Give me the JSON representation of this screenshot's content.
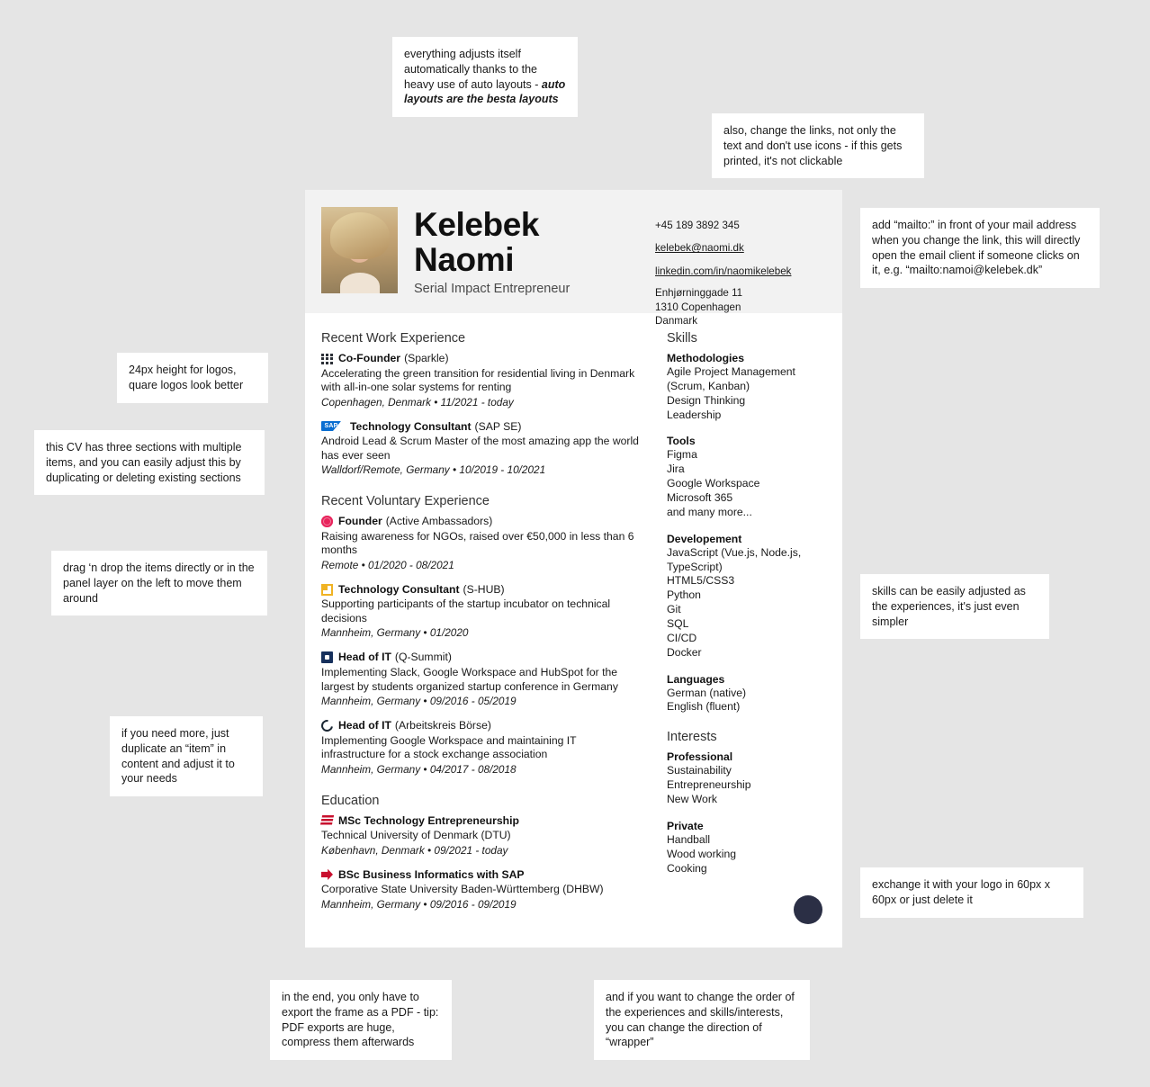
{
  "cv": {
    "header": {
      "photo_alt": "portrait-photo",
      "name": "Kelebek\nNaomi",
      "name_line1": "Kelebek",
      "name_line2": "Naomi",
      "subtitle": "Serial Impact Entrepreneur",
      "phone": "+45 189 3892 345",
      "email": "kelebek@naomi.dk",
      "linkedin": "linkedin.com/in/naomikelebek",
      "address_line1": "Enhjørninggade 11",
      "address_line2": "1310 Copenhagen",
      "address_line3": "Danmark"
    },
    "sections": [
      {
        "title": "Recent Work Experience",
        "items": [
          {
            "icon": "sparkle-logo-icon",
            "role": "Co-Founder",
            "org": "(Sparkle)",
            "desc": "Accelerating the green transition for residential living in Denmark with all-in-one solar systems for renting",
            "meta": "Copenhagen, Denmark • 11/2021 - today"
          },
          {
            "icon": "sap-logo-icon",
            "role": "Technology Consultant",
            "org": "(SAP SE)",
            "desc": "Android Lead & Scrum Master of the most amazing app the world has ever seen",
            "meta": "Walldorf/Remote, Germany • 10/2019 - 10/2021"
          }
        ]
      },
      {
        "title": "Recent Voluntary Experience",
        "items": [
          {
            "icon": "active-ambassadors-logo-icon",
            "role": "Founder",
            "org": "(Active Ambassadors)",
            "desc": "Raising awareness for NGOs, raised over €50,000 in less than 6 months",
            "meta": "Remote • 01/2020 - 08/2021"
          },
          {
            "icon": "s-hub-logo-icon",
            "role": "Technology Consultant",
            "org": "(S-HUB)",
            "desc": "Supporting participants of the startup incubator on technical decisions",
            "meta": "Mannheim, Germany • 01/2020"
          },
          {
            "icon": "q-summit-logo-icon",
            "role": "Head of IT",
            "org": "(Q-Summit)",
            "desc": "Implementing Slack, Google Workspace and HubSpot for the largest by students organized startup conference in Germany",
            "meta": "Mannheim, Germany • 09/2016 - 05/2019"
          },
          {
            "icon": "arbeitskreis-boerse-logo-icon",
            "role": "Head of IT",
            "org": "(Arbeitskreis Börse)",
            "desc": "Implementing Google Workspace and maintaining IT infrastructure for a stock exchange association",
            "meta": "Mannheim, Germany • 04/2017 - 08/2018"
          }
        ]
      },
      {
        "title": "Education",
        "items": [
          {
            "icon": "dtu-logo-icon",
            "role": "MSc Technology Entrepreneurship",
            "org": "",
            "desc": "Technical University of Denmark (DTU)",
            "meta": "København, Denmark • 09/2021 - today"
          },
          {
            "icon": "dhbw-logo-icon",
            "role": "BSc Business Informatics with SAP",
            "org": "",
            "desc": "Corporative State University Baden-Württemberg (DHBW)",
            "meta": "Mannheim, Germany • 09/2016 - 09/2019"
          }
        ]
      }
    ],
    "skills": {
      "title": "Skills",
      "groups": [
        {
          "head": "Methodologies",
          "lines": [
            "Agile Project Management (Scrum, Kanban)",
            "Design Thinking",
            "Leadership"
          ]
        },
        {
          "head": "Tools",
          "lines": [
            "Figma",
            "Jira",
            "Google Workspace",
            "Microsoft 365",
            "and many more..."
          ]
        },
        {
          "head": "Developement",
          "lines": [
            "JavaScript (Vue.js, Node.js, TypeScript)",
            "HTML5/CSS3",
            "Python",
            "Git",
            "SQL",
            "CI/CD",
            "Docker"
          ]
        },
        {
          "head": "Languages",
          "lines": [
            "German (native)",
            "English (fluent)"
          ]
        }
      ]
    },
    "interests": {
      "title": "Interests",
      "groups": [
        {
          "head": "Professional",
          "lines": [
            "Sustainability",
            "Entrepreneurship",
            "New Work"
          ]
        },
        {
          "head": "Private",
          "lines": [
            "Handball",
            "Wood working",
            "Cooking"
          ]
        }
      ]
    },
    "footer_logo": "company-logo-placeholder"
  },
  "notes": [
    {
      "id": "note-auto-layouts",
      "text": "everything adjusts itself automatically thanks to the heavy use of auto layouts - ",
      "bold": "auto layouts are the besta layouts"
    },
    {
      "id": "note-links",
      "text": "also, change the links, not only the text and don't use icons - if this gets printed, it's not clickable"
    },
    {
      "id": "note-mailto",
      "text": "add “mailto:” in front of your mail address when you change the link, this will directly open the email client if someone clicks on it, e.g. “mailto:namoi@kelebek.dk”"
    },
    {
      "id": "note-logo-size",
      "text": "24px height for logos, quare logos look better"
    },
    {
      "id": "note-three-sections",
      "text": "this CV has three sections with multiple items, and you can easily adjust this by duplicating or deleting existing sections"
    },
    {
      "id": "note-drag-drop",
      "text": "drag ‘n drop the items directly or in the panel layer on the left to move them around"
    },
    {
      "id": "note-duplicate-item",
      "text": "if you need more, just duplicate an “item” in content and adjust it to your needs"
    },
    {
      "id": "note-skills-adjust",
      "text": "skills can be easily adjusted as the experiences, it's just even simpler"
    },
    {
      "id": "note-exchange-logo",
      "text": "exchange it with your logo in 60px x 60px or just delete it"
    },
    {
      "id": "note-export-pdf",
      "text": "in the end, you only have to export the frame as a PDF - tip: PDF exports are huge, compress them afterwards"
    },
    {
      "id": "note-wrapper-direction",
      "text": "and if you want to change the order of the experiences and skills/interests, you can change the direction of  “wrapper”"
    }
  ],
  "colors": {
    "page_background": "#e5e5e5",
    "sheet": "#ffffff",
    "header_band": "#f2f2f2",
    "text": "#1a1a1a",
    "accent_red": "#c8102e",
    "sap_blue": "#0a6ed1",
    "logo_dot": "#2b2f45"
  }
}
